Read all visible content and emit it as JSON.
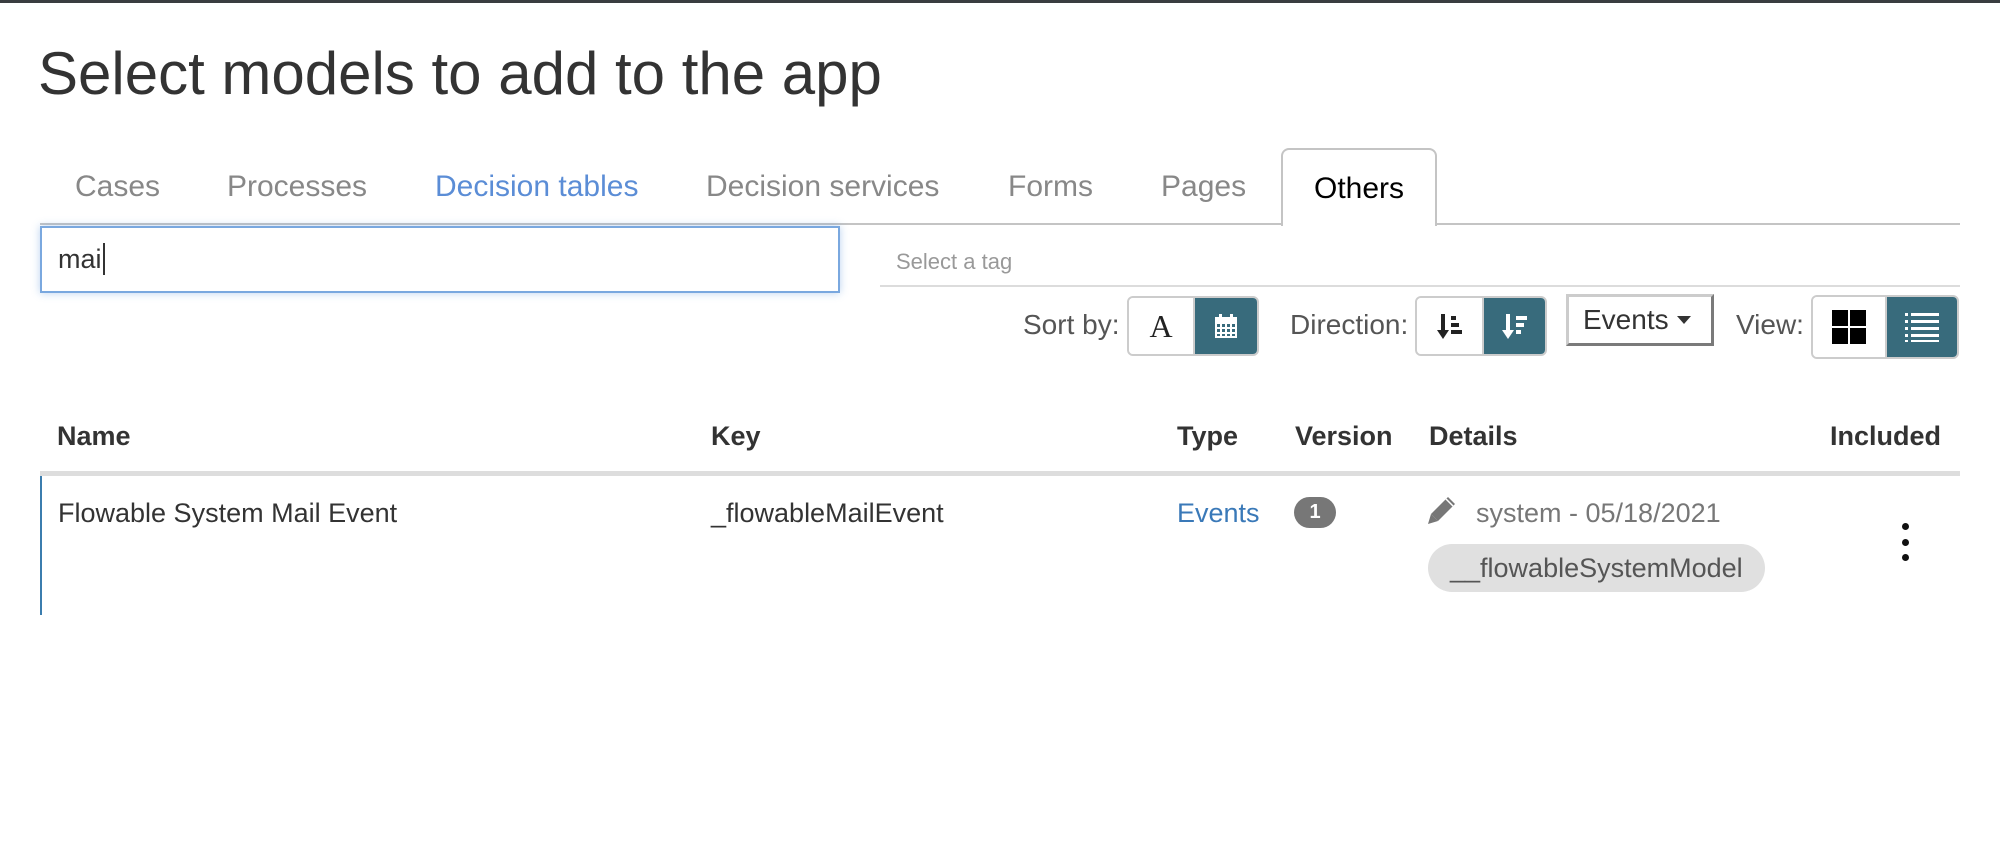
{
  "page": {
    "title": "Select models to add to the app"
  },
  "tabs": [
    {
      "label": "Cases",
      "state": "inactive"
    },
    {
      "label": "Processes",
      "state": "inactive"
    },
    {
      "label": "Decision tables",
      "state": "hover"
    },
    {
      "label": "Decision services",
      "state": "inactive"
    },
    {
      "label": "Forms",
      "state": "inactive"
    },
    {
      "label": "Pages",
      "state": "inactive"
    },
    {
      "label": "Others",
      "state": "active"
    }
  ],
  "filters": {
    "search_value": "mai",
    "tag_placeholder": "Select a tag"
  },
  "toolbar": {
    "sort_label": "Sort by:",
    "sort_options": [
      {
        "name": "alphabetical",
        "glyph": "A",
        "active": false
      },
      {
        "name": "date",
        "icon": "calendar-icon",
        "active": true
      }
    ],
    "direction_label": "Direction:",
    "direction_options": [
      {
        "name": "ascending",
        "icon": "sort-amount-asc-icon",
        "active": false
      },
      {
        "name": "descending",
        "icon": "sort-amount-desc-icon",
        "active": true
      }
    ],
    "type_filter": "Events",
    "view_label": "View:",
    "view_options": [
      {
        "name": "grid",
        "icon": "grid-icon",
        "active": false
      },
      {
        "name": "list",
        "icon": "list-icon",
        "active": true
      }
    ]
  },
  "table": {
    "columns": [
      "Name",
      "Key",
      "Type",
      "Version",
      "Details",
      "Included"
    ],
    "rows": [
      {
        "name": "Flowable System Mail Event",
        "key": "_flowableMailEvent",
        "type": "Events",
        "version": "1",
        "details": "system - 05/18/2021",
        "tag": "__flowableSystemModel"
      }
    ]
  },
  "colors": {
    "accent": "#386b7c",
    "link": "#3a79b8",
    "tab_hover": "#5b8dd6",
    "row_border": "#3b7dae",
    "badge": "#777777",
    "tag_bg": "#e0e0e0"
  }
}
